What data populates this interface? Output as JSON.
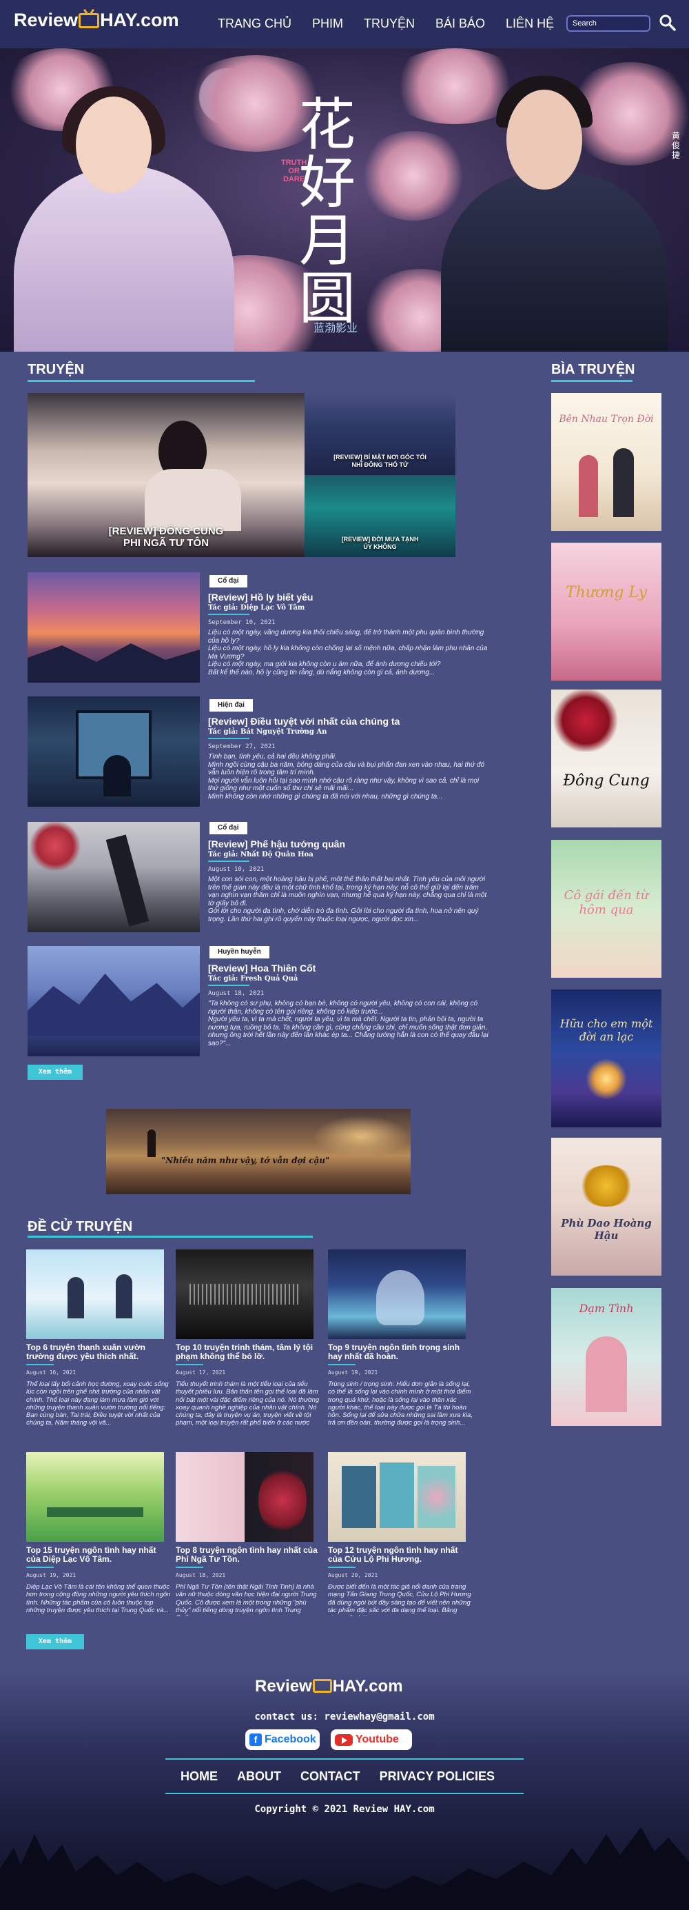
{
  "header": {
    "logo_left": "Review",
    "logo_right": "HAY.com",
    "nav": [
      "TRANG CHỦ",
      "PHIM",
      "TRUYỆN",
      "BÁI BÁO",
      "LIÊN HỆ"
    ],
    "search_placeholder": "Search"
  },
  "hero": {
    "calligraphy": "花好月圆",
    "tag_truth": "TRUTH",
    "tag_or": "OR",
    "tag_dare": "DARE",
    "studio": "蓝渤影业",
    "side_name": "黄俊捷"
  },
  "truyen_section": {
    "title": "TRUYỆN",
    "featured": [
      {
        "label": "[REVIEW] ĐÔNG CUNG\nPHI NGÃ TƯ TÔN"
      },
      {
        "label": "[REVIEW] BÍ MẬT NƠI GÓC TỐI\nNHĨ ĐÔNG THỐ TỬ"
      },
      {
        "label": "[REVIEW] ĐỜI MƯA TẠNH\nÚY KHÔNG"
      }
    ],
    "stories": [
      {
        "genre": "Cổ đại",
        "title": "[Review] Hồ ly biết yêu",
        "author": "Tác giả: Diệp Lạc Vô Tâm",
        "date": "September 10, 2021",
        "excerpt": "Liệu có một ngày, vầng dương kia thôi chiếu sáng, để trở thành một phu quân bình thường của hồ ly?\nLiệu có một ngày, hồ ly kia không còn chống lại số mệnh nữa, chấp nhận làm phu nhân của Ma Vương?\nLiệu có một ngày, ma giới kia không còn u ám nữa, để ánh dương chiếu tới?\nBất kể thế nào, hồ ly cũng tin rằng, dù nắng không còn gì cả, ánh dương..."
      },
      {
        "genre": "Hiện đại",
        "title": "[Review] Điều tuyệt vời nhất của chúng ta",
        "author": "Tác giả: Bát Nguyệt Trường An",
        "date": "September 27, 2021",
        "excerpt": "Tình bạn, tình yêu, cả hai đều không phải.\nMình ngồi cùng cậu ba năm, bóng dáng của cậu và bụi phấn đan xen vào nhau, hai thứ đó vẫn luôn hiện rõ trong tâm trí mình.\nMọi người vẫn luôn hỏi tại sao mình nhớ cậu rõ ràng như vậy, không vì sao cả, chỉ là mọi thứ giống như một cuốn sổ thu chi sẽ mãi mãi...\nMình không còn nhớ những gì chúng ta đã nói với nhau, những gì chúng ta..."
      },
      {
        "genre": "Cổ đại",
        "title": "[Review] Phế hậu tướng quân",
        "author": "Tác giả: Nhất Độ Quân Hoa",
        "date": "August 10, 2021",
        "excerpt": "Một con sói con, một hoàng hậu bị phế, một thế thân thất bại nhất. Tình yêu của mỗi người trên thế gian này đều là một chữ tình khổ tại, trong ký hạn này, nỗ cô thể giữ lại đến trăm vạn nghìn vạn thăm chỉ là muôn nghìn vạn, nhưng hễ qua ký hạn này, chẳng qua chỉ là một tờ giấy bỏ đi.\nGởi lời cho người đa tình, chớ diễn trò đa tình. Gởi lời cho người đa tình, hoa nở nên quý trọng. Lần thứ hai ghi rõ quyển này thuộc loại ngược, người đọc xin..."
      },
      {
        "genre": "Huyền huyễn",
        "title": "[Review] Hoa Thiên Cốt",
        "author": "Tác giả: Fresh Quả Quả",
        "date": "August 18, 2021",
        "excerpt": "\"Ta không có sư phụ, không có bạn bè, không có người yêu, không có con cái, không có người thân, không có tên gọi riêng, không có kiếp trước...\nNgười yêu ta, vì ta mà chết, người ta yêu, vì ta mà chết. Người ta tin, phản bội ta, người ta nương tựa, ruồng bỏ ta. Ta không cần gì, cũng chẳng cầu chi, chỉ muốn sống thật đơn giản, nhưng ông trời hết lần này đến lần khác ép ta... Chẳng tướng hẳn là con có thể quay đầu lại sao?\"..."
      }
    ],
    "more_button": "Xem thêm"
  },
  "banner": {
    "quote": "\"Nhiều năm như vậy, tớ vẫn đợi cậu\""
  },
  "recommend": {
    "title": "ĐỀ CỬ TRUYỆN",
    "items": [
      {
        "title": "Top 6 truyện thanh xuân vườn trường được yêu thích nhất.",
        "date": "August 16, 2021",
        "excerpt": "Thể loại lấy bối cảnh học đường, xoay cuộc sống lúc còn ngồi trên ghế nhà trường của nhân vật chính. Thể loại này đang làm mưa làm gió với những truyện thanh xuân vườn trường nổi tiếng: Bạn cùng bàn, Tai trái, Điều tuyệt vời nhất của chúng ta, Năm tháng vội vã..."
      },
      {
        "title": "Top 10 truyện trinh thám, tâm lý tội phạm không thể bỏ lỡ.",
        "date": "August 17, 2021",
        "excerpt": "Tiểu thuyết trinh thám là một tiểu loại của tiểu thuyết phiêu lưu. Bản thân tên gọi thể loại đã làm nổi bật một vài đặc điểm riêng của nó. Nó thường xoay quanh nghề nghiệp của nhân vật chính. Nó chúng ta, đây là truyện vụ án, truyện viết về tội phạm, một loại truyện rất phổ biến ở các nước phương Tây..."
      },
      {
        "title": "Top 9 truyện ngôn tình trọng sinh hay nhất đã hoàn.",
        "date": "August 19, 2021",
        "excerpt": "Trùng sinh / trọng sinh: Hiểu đơn giản là sống lại, có thể là sống lại vào chính mình ở một thời điểm trong quá khứ, hoặc là sống lại vào thân xác người khác, thể loại này được gọi là Tá thi hoàn hồn. Sống lại để sửa chữa những sai lầm xưa kia, trả ơn đền oán, thường được gọi là trọng sinh..."
      },
      {
        "title": "Top 15 truyện ngôn tình hay nhất của Diệp Lạc Vô Tâm.",
        "date": "August 19, 2021",
        "excerpt": "Diệp Lạc Vô Tâm là cái tên không thể quen thuộc hơn trong cộng đồng những người yêu thích ngôn tình. Những tác phẩm của cô luôn thuộc top những truyện được yêu thích tại Trung Quốc và..."
      },
      {
        "title": "Top 8 truyện ngôn tình hay nhất của Phỉ Ngã Tư Tồn.",
        "date": "August 18, 2021",
        "excerpt": "Phỉ Ngã Tư Tồn (tên thật Ngải Tinh Tinh) là nhà văn nữ thuộc dòng văn học hiện đại người Trung Quốc. Cô được xem là một trong những \"phù thủy\" nổi tiếng dòng truyện ngôn tình Trung Quốc..."
      },
      {
        "title": "Top 12 truyện ngôn tình hay nhất của Cửu Lộ Phi Hương.",
        "date": "August 20, 2021",
        "excerpt": "Được biết đến là một tác giả nổi danh của trang mạng Tấn Giang Trung Quốc, Cửu Lộ Phi Hương đã dùng ngòi bút đầy sáng tạo để viết nên những tác phẩm đặc sắc với đa dạng thể loại. Bằng giọng văn hài..."
      }
    ],
    "more_button": "Xem thêm"
  },
  "sidebar": {
    "title": "BÌA TRUYỆN",
    "covers": [
      {
        "text": "Bên Nhau Trọn Đời"
      },
      {
        "text": "Thương Ly"
      },
      {
        "text": "Đông Cung"
      },
      {
        "text": "Cô gái đến từ hôm qua"
      },
      {
        "text": "Hữu cho em một đời an lạc"
      },
      {
        "text": "Phù Dao Hoàng Hậu"
      },
      {
        "text": "Dạm Tình"
      }
    ]
  },
  "footer": {
    "logo_left": "Review",
    "logo_right": "HAY.com",
    "contact": "contact us: reviewhay@gmail.com",
    "facebook": "Facebook",
    "youtube": "Youtube",
    "links": [
      "HOME",
      "ABOUT",
      "CONTACT",
      "PRIVACY POLICIES"
    ],
    "copyright": "Copyright © 2021 Review HAY.com"
  },
  "colors": {
    "page_bg": "#4a4f82",
    "header_bg": "#2a2e5e",
    "accent": "#3fc4d8",
    "logo_tv": "#f0b429",
    "facebook": "#1877f2",
    "youtube": "#e52d27"
  }
}
